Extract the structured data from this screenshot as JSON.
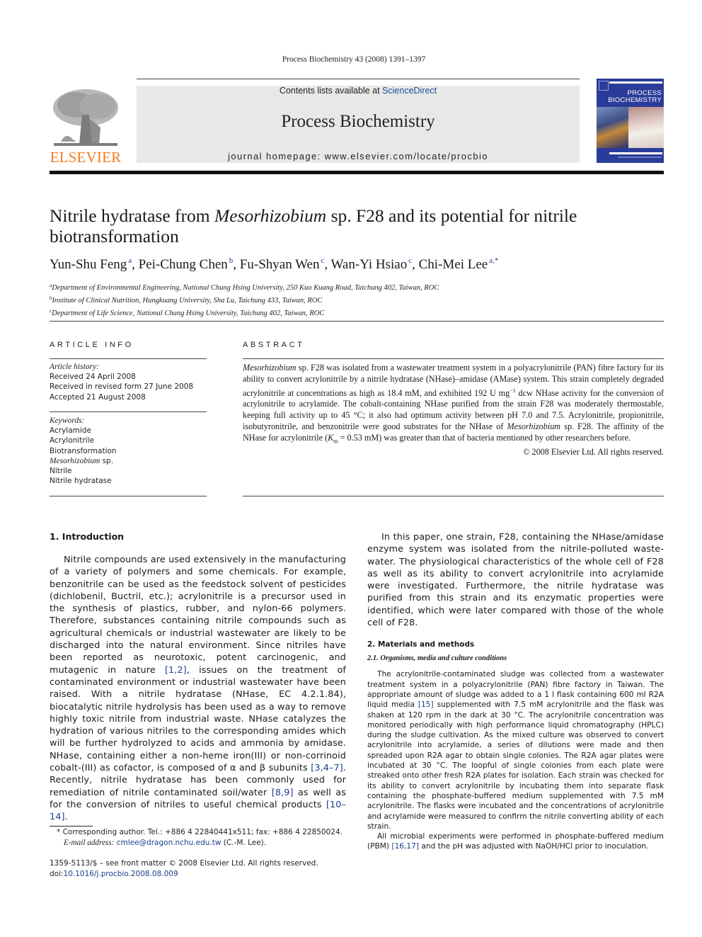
{
  "running_head": "Process Biochemistry 43 (2008) 1391–1397",
  "masthead": {
    "publisher_wordmark": "ELSEVIER",
    "contents_prefix": "Contents lists available at ",
    "contents_link": "ScienceDirect",
    "journal_title": "Process Biochemistry",
    "homepage": "journal homepage: www.elsevier.com/locate/procbio",
    "cover": {
      "line1": "PROCESS",
      "line2": "BIOCHEMISTRY",
      "background": "#2a3c99"
    },
    "publisher_color": "#f07b1f",
    "link_color": "#1b4f9c"
  },
  "article": {
    "title_part1": "Nitrile hydratase from ",
    "title_italic": "Mesorhizobium",
    "title_part2": " sp. F28 and its potential for nitrile biotransformation",
    "authors": [
      {
        "name": "Yun-Shu Feng",
        "aff": "a"
      },
      {
        "name": "Pei-Chung Chen",
        "aff": "b"
      },
      {
        "name": "Fu-Shyan Wen",
        "aff": "c"
      },
      {
        "name": "Wan-Yi Hsiao",
        "aff": "c"
      },
      {
        "name": "Chi-Mei Lee",
        "aff": "a,*"
      }
    ],
    "affiliations": [
      {
        "key": "a",
        "text": "Department of Environmental Engineering, National Chung Hsing University, 250 Kuo Kuang Road, Taichung 402, Taiwan, ROC"
      },
      {
        "key": "b",
        "text": "Institute of Clinical Nutrition, Hungkuang University, Sha Lu, Taichung 433, Taiwan, ROC"
      },
      {
        "key": "c",
        "text": "Department of Life Science, National Chung Hsing University, Taichung 402, Taiwan, ROC"
      }
    ]
  },
  "article_info": {
    "heading": "ARTICLE INFO",
    "history_label": "Article history:",
    "history": [
      "Received 24 April 2008",
      "Received in revised form 27 June 2008",
      "Accepted 21 August 2008"
    ],
    "keywords_label": "Keywords:",
    "keywords": [
      "Acrylamide",
      "Acrylonitrile",
      "Biotransformation",
      "Mesorhizobium",
      "Nitrile",
      "Nitrile hydratase"
    ],
    "keyword_suffix_4": " sp."
  },
  "abstract": {
    "heading": "ABSTRACT",
    "s1_italic": "Mesorhizobium",
    "s1": " sp. F28 was isolated from a wastewater treatment system in a polyacrylonitrile (PAN) fibre factory for its ability to convert acrylonitrile by a nitrile hydratase (NHase)–amidase (AMase) system. This strain completely degraded acrylonitrile at concentrations as high as 18.4 mM, and exhibited 192 U mg",
    "s1_sup": "−1",
    "s2": " dcw NHase activity for the conversion of acrylonitrile to acrylamide. The cobalt-containing NHase purified from the strain F28 was moderately thermostable, keeping full activity up to 45 °C; it also had optimum activity between pH 7.0 and 7.5. Acrylonitrile, propionitrile, isobutyronitrile, and benzonitrile were good substrates for the NHase of ",
    "s2_italic": "Mesorhizobium",
    "s3": " sp. F28. The affinity of the NHase for acrylonitrile (",
    "km_k": "K",
    "km_sub": "m",
    "s4": " = 0.53 mM) was greater than that of bacteria mentioned by other researchers before.",
    "copyright": "© 2008 Elsevier Ltd. All rights reserved."
  },
  "intro": {
    "heading": "1.  Introduction",
    "p1_a": "Nitrile compounds are used extensively in the manufacturing of a variety of polymers and some chemicals. For example, benzonitrile can be used as the feedstock solvent of pesticides (dichlobenil, Buctril, etc.); acrylonitrile is a precursor used in the synthesis of plastics, rubber, and nylon-66 polymers. Therefore, substances containing nitrile compounds such as agricultural chemicals or industrial wastewater are likely to be discharged into the natural environment. Since nitriles have been reported as neurotoxic, potent carcinogenic, and mutagenic in nature ",
    "cite1": "[1,2]",
    "p1_b": ", issues on the treatment of contaminated environment or industrial wastewater have been raised. With a nitrile hydratase (NHase, EC 4.2.1.84), biocatalytic nitrile hydrolysis has been used as a way to remove highly toxic nitrile from industrial waste. NHase catalyzes the hydration of various nitriles to the corresponding amides which will be further hydrolyzed to acids and ammonia by amidase. NHase, containing either a non-heme iron(III) or non-corrinoid cobalt-(III) as cofactor, is composed of α and β subunits ",
    "cite2": "[3,4–7]",
    "p1_c": ". Recently, nitrile hydratase has been commonly used for remediation of nitrile contaminated soil/water ",
    "cite3": "[8,9]",
    "p1_d": " as well as for the conversion of nitriles to useful chemical products ",
    "cite4": "[10–14]",
    "p1_e": ".",
    "p2": "In this paper, one strain, F28, containing the NHase/amidase enzyme system was isolated from the nitrile-polluted waste-water. The physiological characteristics of the whole cell of F28 as well as its ability to convert acrylonitrile into acrylamide were investigated. Furthermore, the nitrile hydratase was purified from this strain and its enzymatic properties were identified, which were later compared with those of the whole cell of F28."
  },
  "methods": {
    "heading": "2.  Materials and methods",
    "sub_heading": "2.1.  Organisms, media and culture conditions",
    "p1_a": "The acrylonitrile-contaminated sludge was collected from a wastewater treatment system in a polyacrylonitrile (PAN) fibre factory in Taiwan. The appropriate amount of sludge was added to a 1 l flask containing 600 ml R2A liquid media ",
    "cite1": "[15]",
    "p1_b": " supplemented with 7.5 mM acrylonitrile and the flask was shaken at 120 rpm in the dark at 30 °C. The acrylonitrile concentration was monitored periodically with high performance liquid chromatography (HPLC) during the sludge cultivation. As the mixed culture was observed to convert acrylonitrile into acrylamide, a series of dilutions were made and then spreaded upon R2A agar to obtain single colonies. The R2A agar plates were incubated at 30 °C. The loopful of single colonies from each plate were streaked onto other fresh R2A plates for isolation. Each strain was checked for its ability to convert acrylonitrile by incubating them into separate flask containing the phosphate-buffered medium supplemented with 7.5 mM acrylonitrile. The flasks were incubated and the concentrations of acrylonitrile and acrylamide were measured to confirm the nitrile converting ability of each strain.",
    "p2_a": "All microbial experiments were performed in phosphate-buffered medium (PBM) ",
    "cite2": "[16,17]",
    "p2_b": " and the pH was adjusted with NaOH/HCl prior to inoculation."
  },
  "footnote": {
    "marker": "*",
    "contact": " Corresponding author. Tel.: +886 4 22840441x511; fax: +886 4 22850024.",
    "email_label": "E-mail address:",
    "email": "cmlee@dragon.nchu.edu.tw",
    "email_suffix": " (C.-M. Lee)."
  },
  "front_matter": {
    "issn_line": "1359-5113/$ – see front matter © 2008 Elsevier Ltd. All rights reserved.",
    "doi_prefix": "doi:",
    "doi": "10.1016/j.procbio.2008.08.009"
  }
}
